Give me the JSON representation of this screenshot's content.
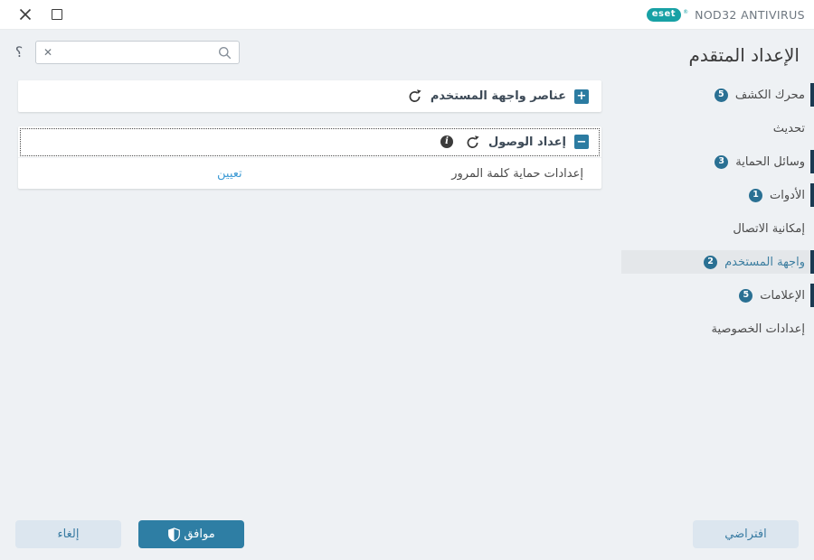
{
  "titlebar": {
    "logo_text": "eset",
    "registered_mark": "®",
    "product": "NOD32 ANTIVIRUS"
  },
  "help": {
    "icon": "؟"
  },
  "search": {
    "value": "",
    "placeholder": "",
    "clear_icon": "✕"
  },
  "sidebar": {
    "title": "الإعداد المتقدم",
    "items": [
      {
        "label": "محرك الكشف",
        "badge": "5",
        "selected": false
      },
      {
        "label": "تحديث",
        "badge": "",
        "selected": false
      },
      {
        "label": "وسائل الحماية",
        "badge": "3",
        "selected": false
      },
      {
        "label": "الأدوات",
        "badge": "1",
        "selected": false
      },
      {
        "label": "إمكانية الاتصال",
        "badge": "",
        "selected": false
      },
      {
        "label": "واجهة المستخدم",
        "badge": "2",
        "selected": true
      },
      {
        "label": "الإعلامات",
        "badge": "5",
        "selected": false
      },
      {
        "label": "إعدادات الخصوصية",
        "badge": "",
        "selected": false
      }
    ]
  },
  "panels": [
    {
      "title": "عناصر واجهة المستخدم",
      "expander": "+",
      "expanded": false
    },
    {
      "title": "إعداد الوصول",
      "expander": "−",
      "expanded": true,
      "rows": [
        {
          "label": "إعدادات حماية كلمة المرور",
          "action": "تعيين"
        }
      ]
    }
  ],
  "footer": {
    "default_label": "افتراضي",
    "ok_label": "موافق",
    "cancel_label": "إلغاء"
  },
  "colors": {
    "brand_teal": "#18a1a5",
    "accent_blue": "#2e7ea4",
    "expander_blue": "#2b7ba1",
    "badge_blue": "#2a7093",
    "accent_bar_navy": "#1b3a52",
    "link_blue": "#3e9bd5",
    "selected_item_bg": "#e4e7ea",
    "selected_item_text": "#3e7fa1",
    "page_bg": "#eef1f4"
  }
}
